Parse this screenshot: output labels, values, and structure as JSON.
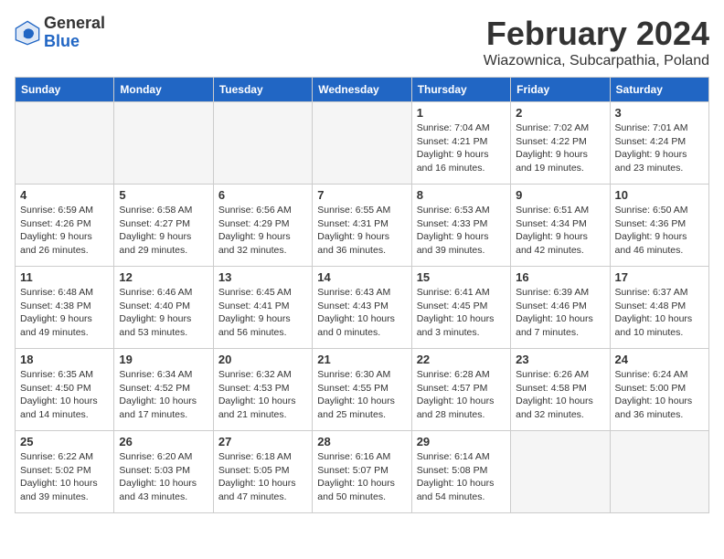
{
  "header": {
    "logo_general": "General",
    "logo_blue": "Blue",
    "month_title": "February 2024",
    "subtitle": "Wiazownica, Subcarpathia, Poland"
  },
  "calendar": {
    "days_of_week": [
      "Sunday",
      "Monday",
      "Tuesday",
      "Wednesday",
      "Thursday",
      "Friday",
      "Saturday"
    ],
    "weeks": [
      [
        {
          "day": "",
          "info": ""
        },
        {
          "day": "",
          "info": ""
        },
        {
          "day": "",
          "info": ""
        },
        {
          "day": "",
          "info": ""
        },
        {
          "day": "1",
          "info": "Sunrise: 7:04 AM\nSunset: 4:21 PM\nDaylight: 9 hours\nand 16 minutes."
        },
        {
          "day": "2",
          "info": "Sunrise: 7:02 AM\nSunset: 4:22 PM\nDaylight: 9 hours\nand 19 minutes."
        },
        {
          "day": "3",
          "info": "Sunrise: 7:01 AM\nSunset: 4:24 PM\nDaylight: 9 hours\nand 23 minutes."
        }
      ],
      [
        {
          "day": "4",
          "info": "Sunrise: 6:59 AM\nSunset: 4:26 PM\nDaylight: 9 hours\nand 26 minutes."
        },
        {
          "day": "5",
          "info": "Sunrise: 6:58 AM\nSunset: 4:27 PM\nDaylight: 9 hours\nand 29 minutes."
        },
        {
          "day": "6",
          "info": "Sunrise: 6:56 AM\nSunset: 4:29 PM\nDaylight: 9 hours\nand 32 minutes."
        },
        {
          "day": "7",
          "info": "Sunrise: 6:55 AM\nSunset: 4:31 PM\nDaylight: 9 hours\nand 36 minutes."
        },
        {
          "day": "8",
          "info": "Sunrise: 6:53 AM\nSunset: 4:33 PM\nDaylight: 9 hours\nand 39 minutes."
        },
        {
          "day": "9",
          "info": "Sunrise: 6:51 AM\nSunset: 4:34 PM\nDaylight: 9 hours\nand 42 minutes."
        },
        {
          "day": "10",
          "info": "Sunrise: 6:50 AM\nSunset: 4:36 PM\nDaylight: 9 hours\nand 46 minutes."
        }
      ],
      [
        {
          "day": "11",
          "info": "Sunrise: 6:48 AM\nSunset: 4:38 PM\nDaylight: 9 hours\nand 49 minutes."
        },
        {
          "day": "12",
          "info": "Sunrise: 6:46 AM\nSunset: 4:40 PM\nDaylight: 9 hours\nand 53 minutes."
        },
        {
          "day": "13",
          "info": "Sunrise: 6:45 AM\nSunset: 4:41 PM\nDaylight: 9 hours\nand 56 minutes."
        },
        {
          "day": "14",
          "info": "Sunrise: 6:43 AM\nSunset: 4:43 PM\nDaylight: 10 hours\nand 0 minutes."
        },
        {
          "day": "15",
          "info": "Sunrise: 6:41 AM\nSunset: 4:45 PM\nDaylight: 10 hours\nand 3 minutes."
        },
        {
          "day": "16",
          "info": "Sunrise: 6:39 AM\nSunset: 4:46 PM\nDaylight: 10 hours\nand 7 minutes."
        },
        {
          "day": "17",
          "info": "Sunrise: 6:37 AM\nSunset: 4:48 PM\nDaylight: 10 hours\nand 10 minutes."
        }
      ],
      [
        {
          "day": "18",
          "info": "Sunrise: 6:35 AM\nSunset: 4:50 PM\nDaylight: 10 hours\nand 14 minutes."
        },
        {
          "day": "19",
          "info": "Sunrise: 6:34 AM\nSunset: 4:52 PM\nDaylight: 10 hours\nand 17 minutes."
        },
        {
          "day": "20",
          "info": "Sunrise: 6:32 AM\nSunset: 4:53 PM\nDaylight: 10 hours\nand 21 minutes."
        },
        {
          "day": "21",
          "info": "Sunrise: 6:30 AM\nSunset: 4:55 PM\nDaylight: 10 hours\nand 25 minutes."
        },
        {
          "day": "22",
          "info": "Sunrise: 6:28 AM\nSunset: 4:57 PM\nDaylight: 10 hours\nand 28 minutes."
        },
        {
          "day": "23",
          "info": "Sunrise: 6:26 AM\nSunset: 4:58 PM\nDaylight: 10 hours\nand 32 minutes."
        },
        {
          "day": "24",
          "info": "Sunrise: 6:24 AM\nSunset: 5:00 PM\nDaylight: 10 hours\nand 36 minutes."
        }
      ],
      [
        {
          "day": "25",
          "info": "Sunrise: 6:22 AM\nSunset: 5:02 PM\nDaylight: 10 hours\nand 39 minutes."
        },
        {
          "day": "26",
          "info": "Sunrise: 6:20 AM\nSunset: 5:03 PM\nDaylight: 10 hours\nand 43 minutes."
        },
        {
          "day": "27",
          "info": "Sunrise: 6:18 AM\nSunset: 5:05 PM\nDaylight: 10 hours\nand 47 minutes."
        },
        {
          "day": "28",
          "info": "Sunrise: 6:16 AM\nSunset: 5:07 PM\nDaylight: 10 hours\nand 50 minutes."
        },
        {
          "day": "29",
          "info": "Sunrise: 6:14 AM\nSunset: 5:08 PM\nDaylight: 10 hours\nand 54 minutes."
        },
        {
          "day": "",
          "info": ""
        },
        {
          "day": "",
          "info": ""
        }
      ]
    ]
  }
}
